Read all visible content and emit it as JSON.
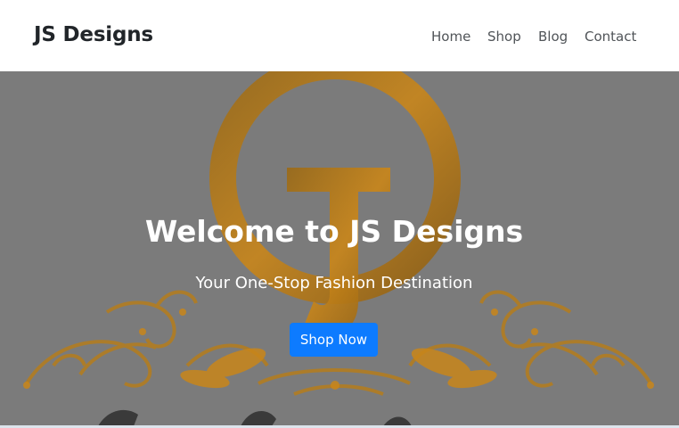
{
  "header": {
    "brand": "JS Designs",
    "nav": [
      {
        "label": "Home"
      },
      {
        "label": "Shop"
      },
      {
        "label": "Blog"
      },
      {
        "label": "Contact"
      }
    ]
  },
  "hero": {
    "title": "Welcome to JS Designs",
    "subtitle": "Your One-Stop Fashion Destination",
    "button_label": "Shop Now",
    "logo_letter": "J"
  },
  "colors": {
    "button": "#0d7bff",
    "overlay": "#7b7b7b",
    "logo_gold": "#c9861a"
  }
}
